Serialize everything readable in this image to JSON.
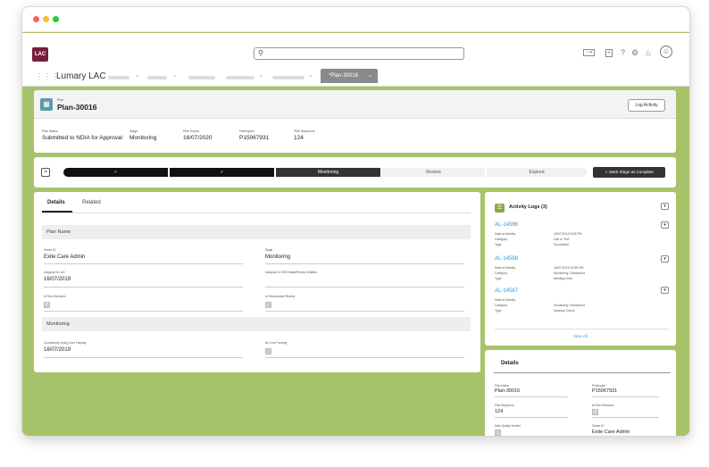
{
  "browser": {
    "dots": [
      "#ff5f57",
      "#febc2e",
      "#28c840"
    ]
  },
  "header": {
    "logo_text": "LAC",
    "search_icon": "search-icon",
    "app_name": "Lumary LAC",
    "active_tab": "*Plan-30016"
  },
  "record": {
    "type_label": "Plan",
    "title": "Plan-30016",
    "log_activity_label": "Log Activity",
    "highlights": [
      {
        "label": "Plan Status",
        "value": "Submitted to NDIA for Approval",
        "link": false
      },
      {
        "label": "Stage",
        "value": "Monitoring",
        "link": false
      },
      {
        "label": "Plan Expiry",
        "value": "16/07/2020",
        "link": false
      },
      {
        "label": "Participant",
        "value": "P15067931",
        "link": true
      },
      {
        "label": "Plan Sequence",
        "value": "124",
        "link": false
      }
    ]
  },
  "path": {
    "stages": [
      "✓",
      "✓",
      "Monitoring",
      "Review",
      "Expired"
    ],
    "mark_complete_label": "✓  Mark Stage as Complete"
  },
  "details": {
    "tabs": [
      "Details",
      "Related"
    ],
    "sections": [
      {
        "title": "Plan Name",
        "fields": [
          {
            "label": "Owner ID",
            "value": "Exite Care Admin",
            "link": true
          },
          {
            "label": "Stage",
            "value": "Monitoring",
            "link": false
          },
          {
            "label": "Assigned to LAC",
            "value": "16/07/2019",
            "link": false
          },
          {
            "label": "Assigned to CRM Intake/Review Initiated",
            "value": "",
            "link": false
          },
          {
            "label": "Is Plan Extension",
            "checkbox": true,
            "checked": true
          },
          {
            "label": "Is Rescheduled Review",
            "checkbox": true,
            "checked": false
          }
        ]
      },
      {
        "title": "Monitoring",
        "fields": [
          {
            "label": "Commenced Using Core Funding",
            "value": "16/07/2019",
            "link": false
          },
          {
            "label": "No Core Funding",
            "checkbox": true,
            "checked": false
          }
        ]
      }
    ]
  },
  "activity": {
    "title": "Activity Logs (3)",
    "items": [
      {
        "id": "AL-14586",
        "rows": [
          [
            "Date of Activity",
            "16/07/2019 9:08 PM"
          ],
          [
            "Category",
            "Call or Text"
          ],
          [
            "Type",
            "Successful"
          ]
        ]
      },
      {
        "id": "AL-14588",
        "rows": [
          [
            "Date of Activity",
            "16/07/2019 12:55 PM"
          ],
          [
            "Category",
            "Monitoring Checkpoint"
          ],
          [
            "Type",
            "Meeting Held"
          ]
        ]
      },
      {
        "id": "AL-14587",
        "rows": [
          [
            "Date of Activity",
            ""
          ],
          [
            "Category",
            "Monitoring Checkpoint"
          ],
          [
            "Type",
            "Desktop Check"
          ]
        ]
      }
    ],
    "view_all": "View All"
  },
  "side_details": {
    "title": "Details",
    "fields": [
      {
        "label": "Plan Name",
        "value": "Plan-30016",
        "link": false
      },
      {
        "label": "Participant",
        "value": "P15067931",
        "link": true
      },
      {
        "label": "Plan Sequence",
        "value": "124",
        "link": false
      },
      {
        "label": "Is Plan Extension",
        "checkbox": true,
        "checked": true
      },
      {
        "label": "Date Quality Verified",
        "checkbox": true,
        "checked": false
      },
      {
        "label": "Owner ID",
        "value": "Exite Care Admin",
        "link": true
      }
    ]
  }
}
